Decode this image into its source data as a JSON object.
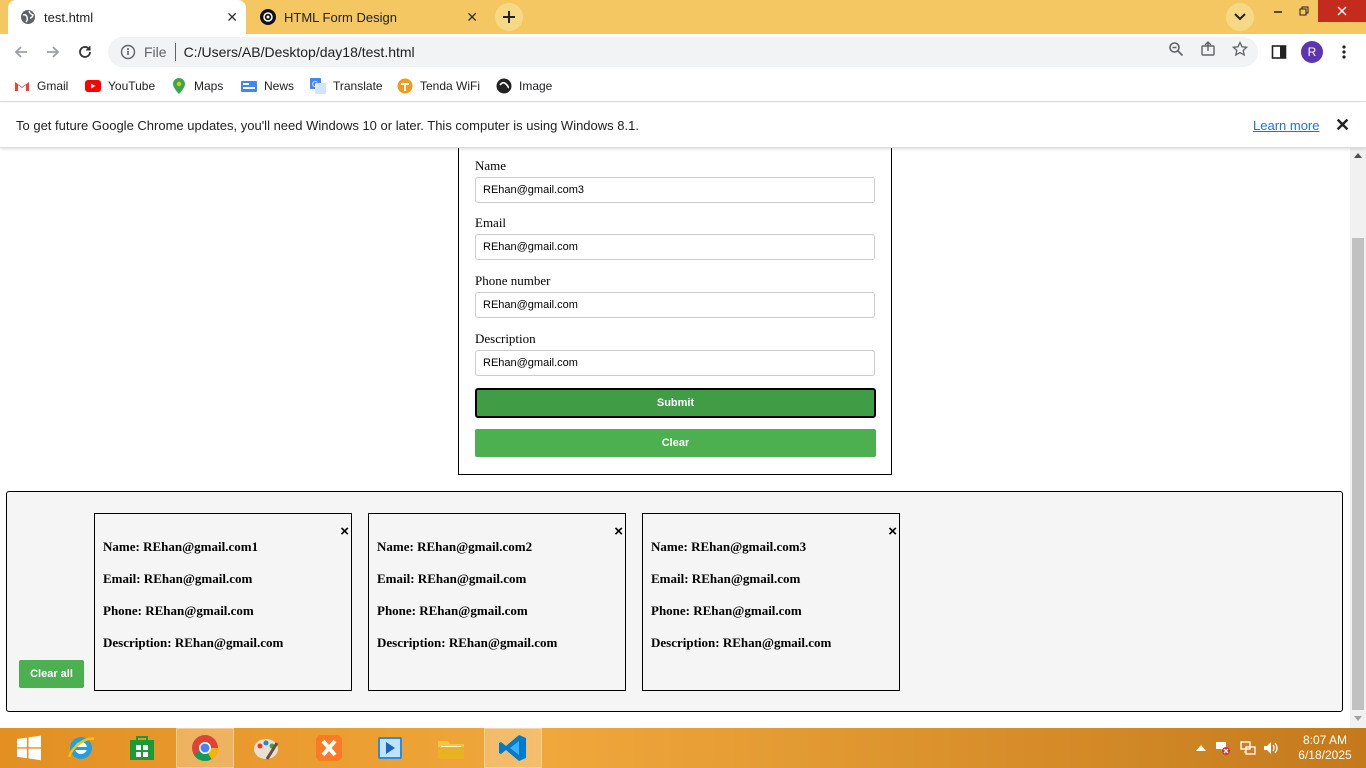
{
  "browser": {
    "tabs": [
      {
        "title": "test.html",
        "active": true,
        "favicon": "globe-icon"
      },
      {
        "title": "HTML Form Design",
        "active": false,
        "favicon": "openai-icon"
      }
    ],
    "address": {
      "scheme": "File",
      "url": "C:/Users/AB/Desktop/day18/test.html"
    },
    "profile_initial": "R",
    "bookmarks": [
      {
        "label": "Gmail",
        "icon": "gmail-icon"
      },
      {
        "label": "YouTube",
        "icon": "youtube-icon"
      },
      {
        "label": "Maps",
        "icon": "maps-icon"
      },
      {
        "label": "News",
        "icon": "news-icon"
      },
      {
        "label": "Translate",
        "icon": "translate-icon"
      },
      {
        "label": "Tenda WiFi",
        "icon": "tenda-icon"
      },
      {
        "label": "Image",
        "icon": "image-icon"
      }
    ],
    "infobar": {
      "message": "To get future Google Chrome updates, you'll need Windows 10 or later. This computer is using Windows 8.1.",
      "link": "Learn more"
    }
  },
  "form": {
    "fields": [
      {
        "label": "Name",
        "value": "REhan@gmail.com3"
      },
      {
        "label": "Email",
        "value": "REhan@gmail.com"
      },
      {
        "label": "Phone number",
        "value": "REhan@gmail.com"
      },
      {
        "label": "Description",
        "value": "REhan@gmail.com"
      }
    ],
    "submit_label": "Submit",
    "clear_label": "Clear"
  },
  "results": {
    "clear_all_label": "Clear all",
    "close_glyph": "×",
    "cards": [
      {
        "name": "Name: REhan@gmail.com1",
        "email": "Email: REhan@gmail.com",
        "phone": "Phone: REhan@gmail.com",
        "description": "Description: REhan@gmail.com"
      },
      {
        "name": "Name: REhan@gmail.com2",
        "email": "Email: REhan@gmail.com",
        "phone": "Phone: REhan@gmail.com",
        "description": "Description: REhan@gmail.com"
      },
      {
        "name": "Name: REhan@gmail.com3",
        "email": "Email: REhan@gmail.com",
        "phone": "Phone: REhan@gmail.com",
        "description": "Description: REhan@gmail.com"
      }
    ]
  },
  "taskbar": {
    "apps": [
      "start-icon",
      "internet-explorer-icon",
      "store-icon",
      "chrome-icon",
      "paint-icon",
      "xampp-icon",
      "media-player-icon",
      "file-explorer-icon",
      "vscode-icon"
    ],
    "time": "8:07 AM",
    "date": "6/18/2025"
  },
  "colors": {
    "tab_strip": "#f5c763",
    "button_green": "#4caf50",
    "link_blue": "#1a73e8",
    "profile_purple": "#5e35b1"
  }
}
